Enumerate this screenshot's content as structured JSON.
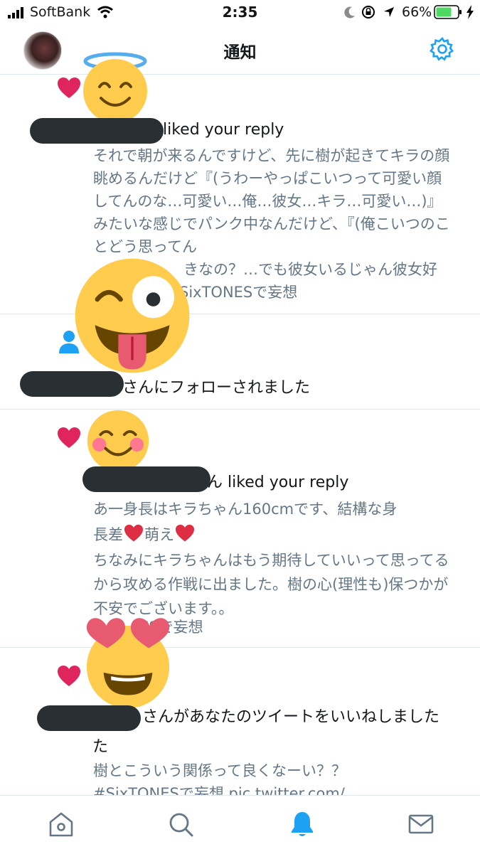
{
  "status_bar": {
    "carrier": "SoftBank",
    "time": "2:35",
    "battery_percent": "66%"
  },
  "header": {
    "title": "通知"
  },
  "notifications": [
    {
      "type": "like",
      "action": "liked your reply",
      "text": "それで朝が来るんですけど、先に樹が起きてキラの顔眺めるんだけど『(うわーやっぱこいつって可愛い顔してんのな…可愛い…俺…彼女…キラ…可愛い…)』みたいな感じでパンク中なんだけど、『(俺こいつのことどう思ってん",
      "text_tail": "きなの？…でも彼女いるじゃん彼女好",
      "text_tail2": "SixTONESで妄想"
    },
    {
      "type": "follow",
      "action": "さんにフォローされました"
    },
    {
      "type": "like",
      "action_prefix": "ん",
      "action": "liked your reply",
      "text_line1": "あ一身長はキラちゃん160cmです、結構な身",
      "text_line2a": "長差",
      "text_line2b": "萌え",
      "text_line3": "ちなみにキラちゃんはもう期待していいって思ってるから攻める作戦に出ました。樹の心(理性も)保つかが不安でございます。。",
      "text_line4": "ESで妄想"
    },
    {
      "type": "like",
      "action": "さんがあなたのツイートをいいねしました",
      "text_line1": "樹とこういう関係って良くなーい？？",
      "text_line2": "#SixTONESで妄想 pic.twitter.com/"
    }
  ],
  "colors": {
    "like_red": "#e0245e",
    "follow_blue": "#1da1f2",
    "accent_blue": "#1da1f2",
    "emoji_yellow": "#ffcc4d",
    "redaction": "#292f33"
  },
  "tabs": [
    {
      "name": "home-icon"
    },
    {
      "name": "search-icon"
    },
    {
      "name": "notifications-icon",
      "active": true
    },
    {
      "name": "messages-icon"
    }
  ]
}
